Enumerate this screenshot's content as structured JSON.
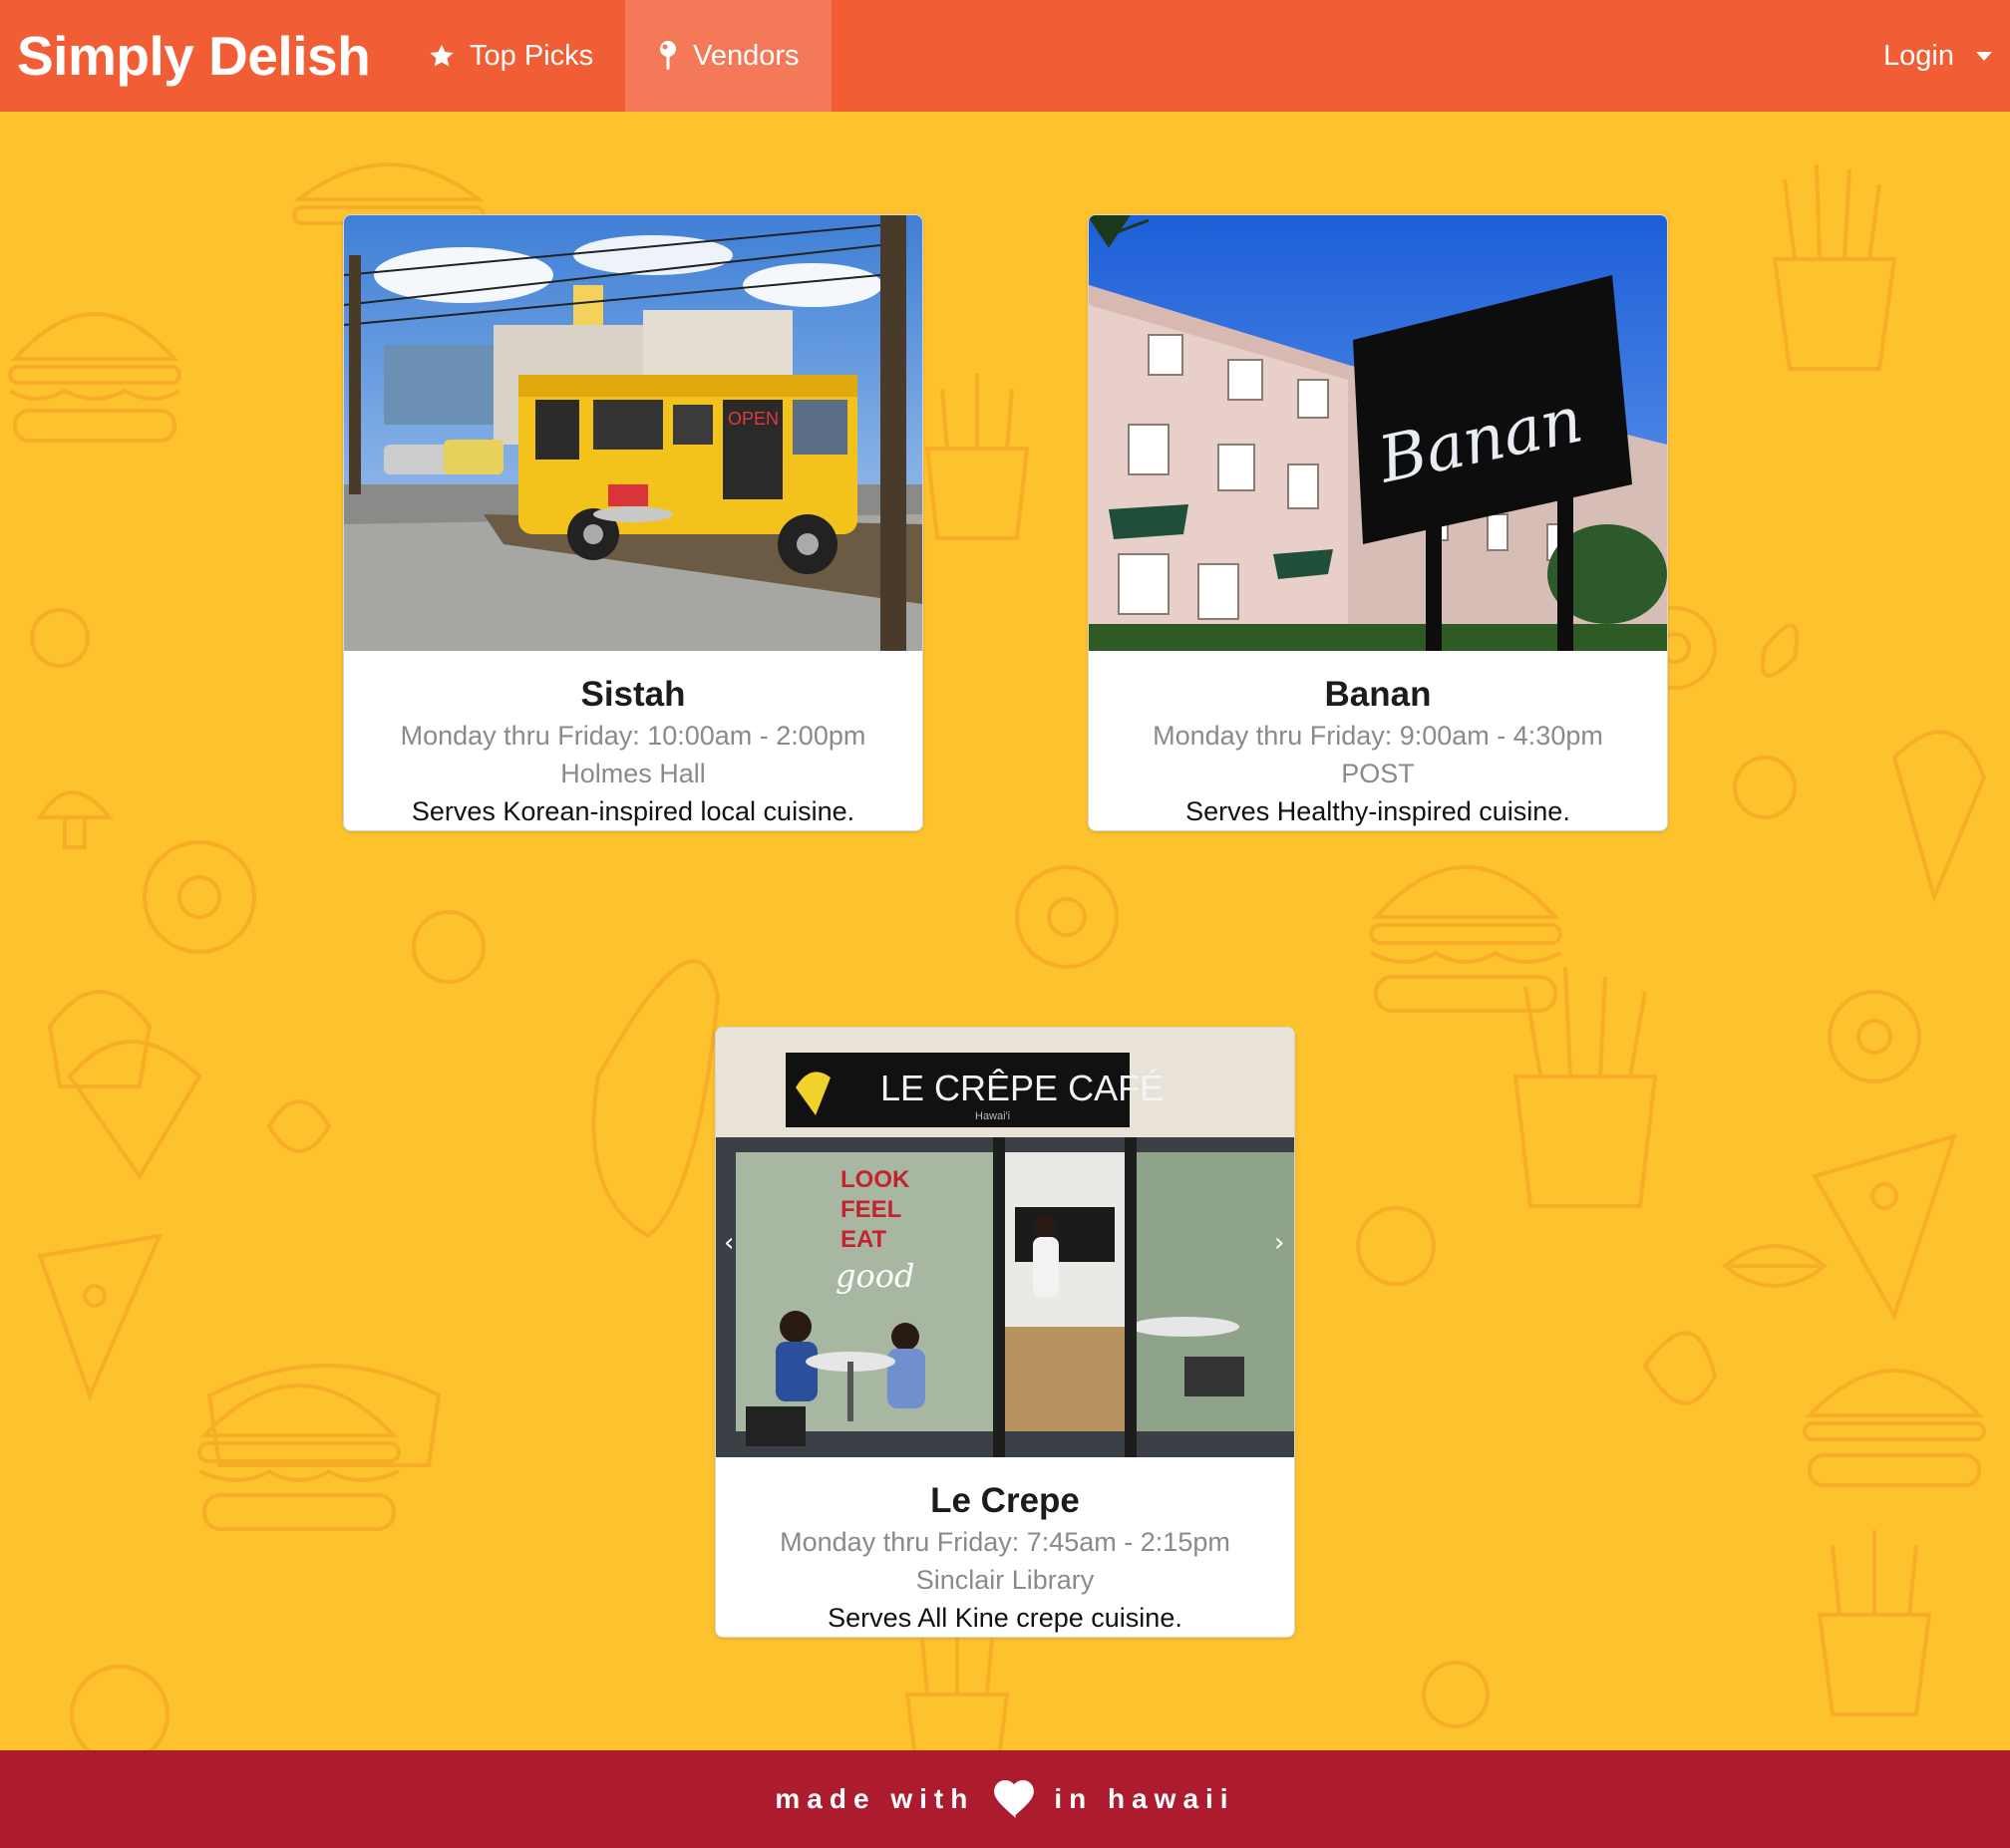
{
  "navbar": {
    "brand": "Simply Delish",
    "items": [
      {
        "label": "Top Picks",
        "icon": "star-icon",
        "active": false
      },
      {
        "label": "Vendors",
        "icon": "map-pin-icon",
        "active": true
      }
    ],
    "login_label": "Login"
  },
  "vendors": [
    {
      "name": "Sistah",
      "hours": "Monday thru Friday: 10:00am - 2:00pm",
      "location": "Holmes Hall",
      "description": "Serves Korean-inspired local cuisine."
    },
    {
      "name": "Banan",
      "hours": "Monday thru Friday: 9:00am - 4:30pm",
      "location": "POST",
      "description": "Serves Healthy-inspired cuisine.",
      "sign_text": "Banan"
    },
    {
      "name": "Le Crepe",
      "hours": "Monday thru Friday: 7:45am - 2:15pm",
      "location": "Sinclair Library",
      "description": "Serves All Kine crepe cuisine.",
      "sign_text": "LE CRÊPE CAFÉ",
      "sign_subtext": "Hawai'i",
      "window_text": [
        "LOOK",
        "FEEL",
        "EAT",
        "good"
      ]
    }
  ],
  "footer": {
    "text_before": "made with",
    "text_after": "in hawaii",
    "icon": "heart-icon"
  },
  "colors": {
    "navbar": "#f15d35",
    "navbar_active": "#f37958",
    "background": "#fec22d",
    "doodle": "#f5a623",
    "footer": "#ac1c2e"
  }
}
